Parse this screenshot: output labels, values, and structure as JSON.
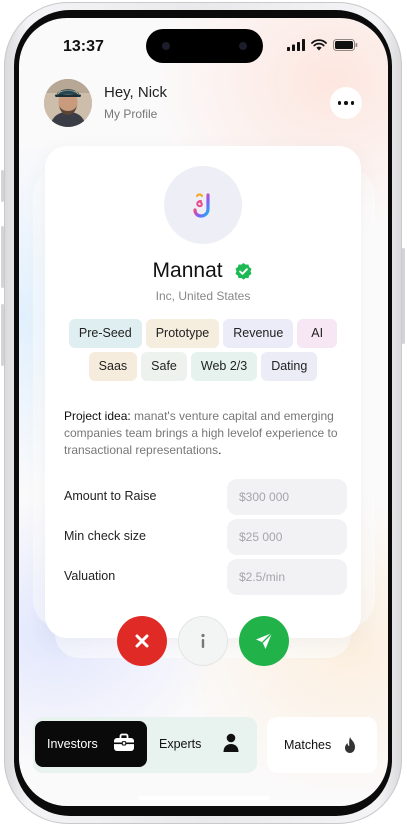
{
  "status_bar": {
    "time": "13:37"
  },
  "header": {
    "greeting": "Hey, Nick",
    "subtitle": "My Profile"
  },
  "company": {
    "name": "Mannat",
    "location": "Inc, United States"
  },
  "tags": [
    {
      "label": "Pre-Seed",
      "color": "#dfeef0"
    },
    {
      "label": "Prototype",
      "color": "#f5edde"
    },
    {
      "label": "Revenue",
      "color": "#ebecf7"
    },
    {
      "label": "AI",
      "color": "#f7e6f4"
    },
    {
      "label": "Saas",
      "color": "#f6ecdd"
    },
    {
      "label": "Safe",
      "color": "#eef2ee"
    },
    {
      "label": "Web 2/3",
      "color": "#e6f2ee"
    },
    {
      "label": "Dating",
      "color": "#ebecf6"
    }
  ],
  "project_idea": {
    "label": "Project idea:",
    "text": "manat's venture capital and emerging companies team brings a high levelof experience to transactional representations",
    "end": "."
  },
  "financials": {
    "amount": {
      "label": "Amount to Raise",
      "placeholder": "$300 000"
    },
    "min_check": {
      "label": "Min check size",
      "placeholder": "$25 000"
    },
    "valuation": {
      "label": "Valuation",
      "placeholder": "$2.5/min"
    }
  },
  "actions": {
    "reject_icon": "close-icon",
    "info_icon": "info-icon",
    "send_icon": "send-icon",
    "reject_color": "#e02a26",
    "send_color": "#21b34a"
  },
  "bottom_nav": {
    "investors": "Investors",
    "experts": "Experts",
    "matches": "Matches"
  },
  "colors": {
    "verified": "#1db954",
    "accent_dark": "#0a0a0a"
  }
}
